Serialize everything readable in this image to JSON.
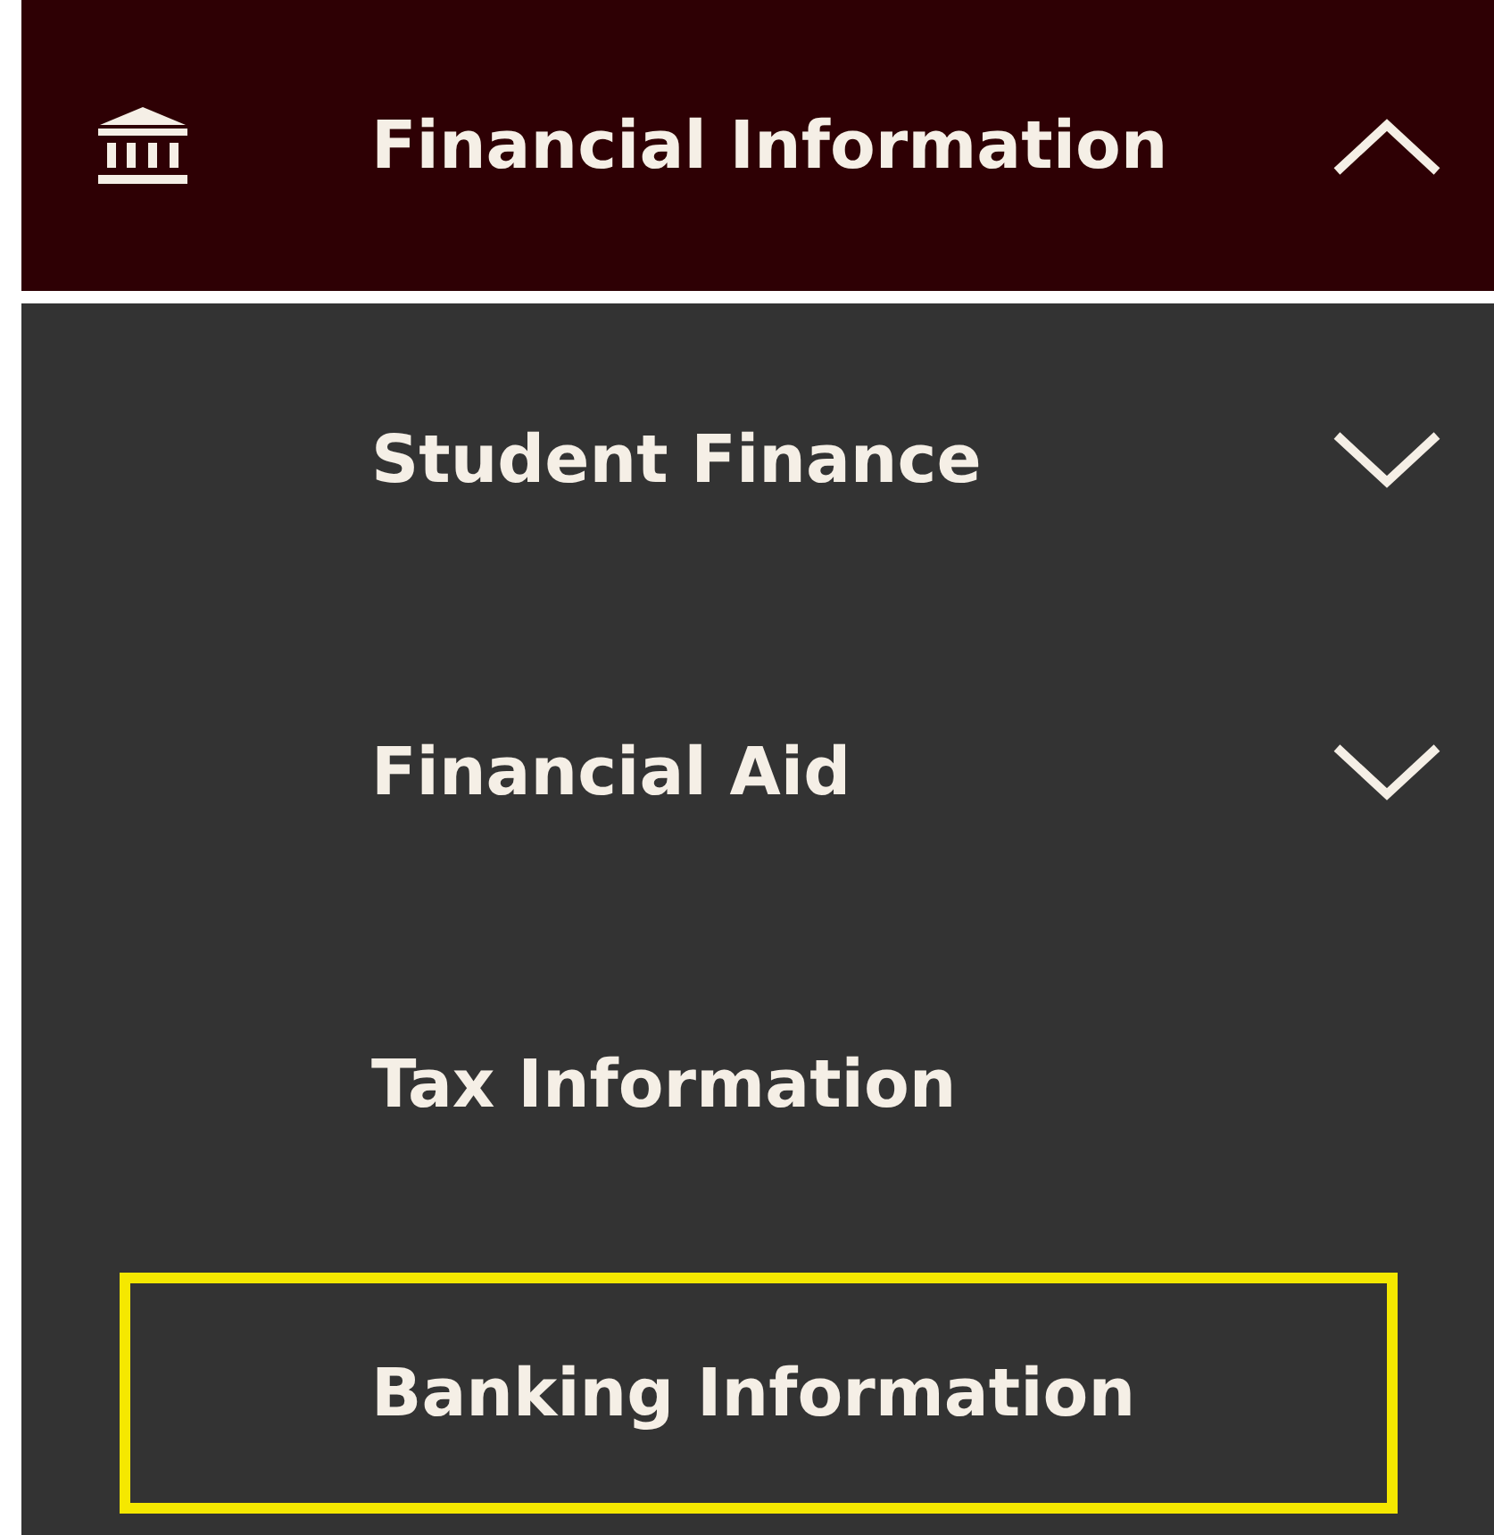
{
  "menu_header": {
    "title": "Financial Information",
    "expanded": true
  },
  "items": [
    {
      "label": "Student Finance",
      "kind": "submenu",
      "expanded": false,
      "highlighted": false
    },
    {
      "label": "Financial Aid",
      "kind": "submenu",
      "expanded": false,
      "highlighted": false
    },
    {
      "label": "Tax Information",
      "kind": "link",
      "highlighted": false
    },
    {
      "label": "Banking Information",
      "kind": "link",
      "highlighted": true
    }
  ]
}
